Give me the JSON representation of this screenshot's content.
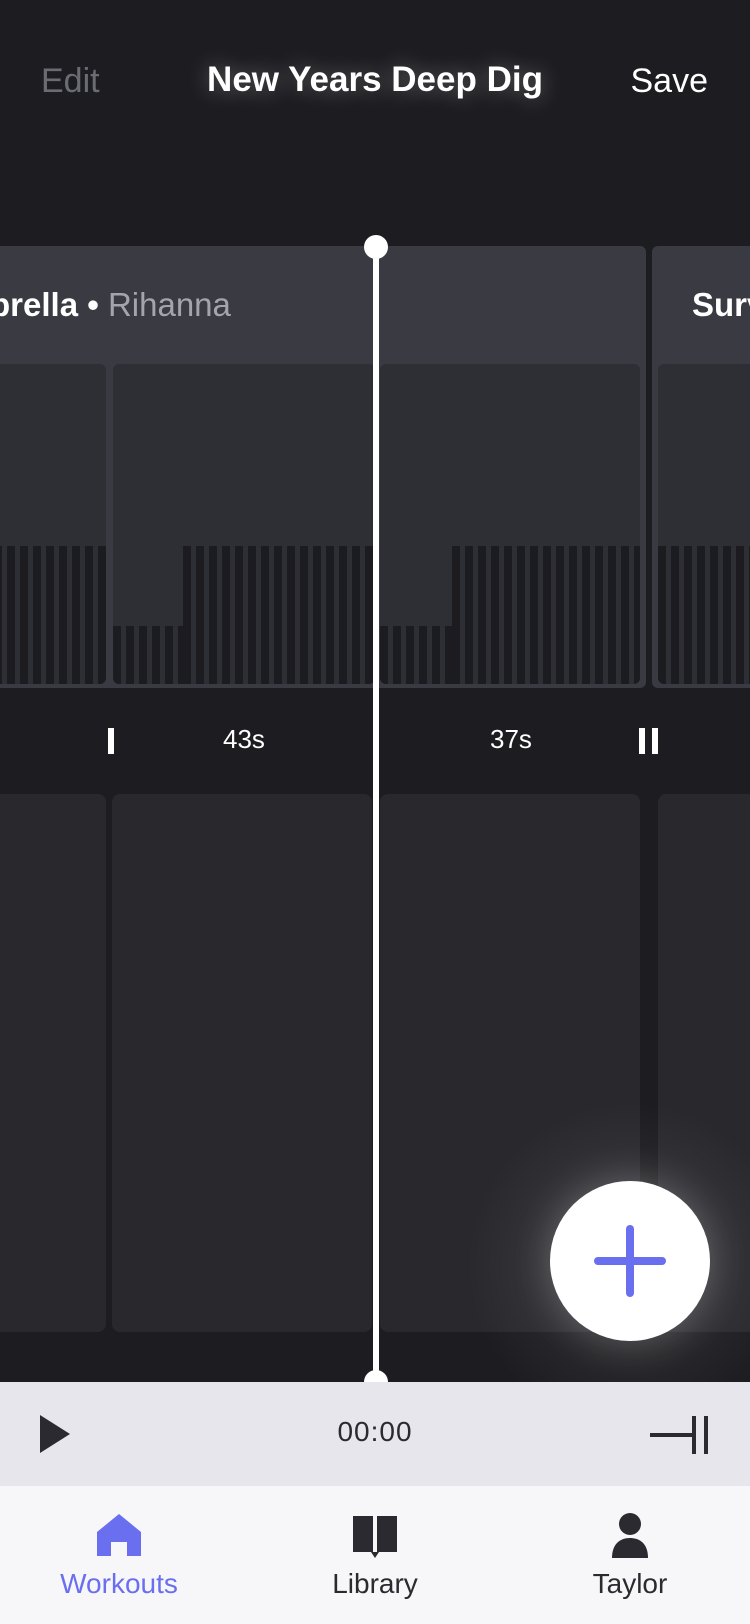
{
  "header": {
    "edit_label": "Edit",
    "title": "New Years Deep Dig",
    "save_label": "Save"
  },
  "tracks": [
    {
      "title": "brella",
      "separator": "•",
      "artist": "Rihanna"
    },
    {
      "title": "Surv",
      "separator": "",
      "artist": ""
    }
  ],
  "intervals": [
    {
      "label": "43s"
    },
    {
      "label": "37s"
    }
  ],
  "transport": {
    "time": "00:00"
  },
  "tabs": [
    {
      "label": "Workouts",
      "icon": "home-icon",
      "active": true
    },
    {
      "label": "Library",
      "icon": "book-icon",
      "active": false
    },
    {
      "label": "Taylor",
      "icon": "person-icon",
      "active": false
    }
  ],
  "colors": {
    "accent": "#6a6ff0",
    "background": "#1d1d21",
    "track": "#3a3a42",
    "card": "#28282d",
    "transport_bg": "#e6e6ec",
    "tabbar_bg": "#f7f7f9"
  }
}
